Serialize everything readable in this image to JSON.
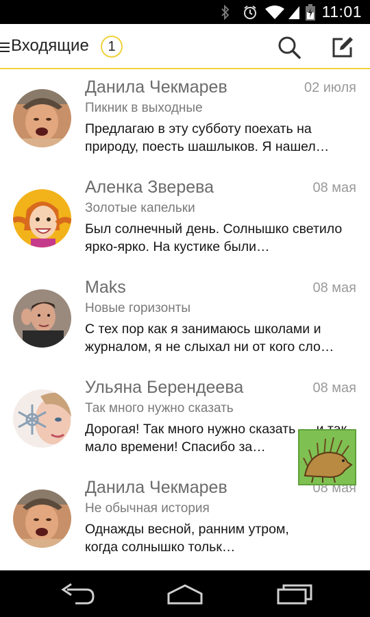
{
  "status_bar": {
    "time": "11:01",
    "icons": [
      "bluetooth-icon",
      "alarm-icon",
      "wifi-icon",
      "signal-icon",
      "battery-icon"
    ]
  },
  "header": {
    "title": "Входящие",
    "unread_count": "1",
    "accent_color": "#f0d23b"
  },
  "messages": [
    {
      "sender": "Данила Чекмарев",
      "date": "02 июля",
      "subject": "Пикник в выходные",
      "preview": "Предлагаю в эту субботу поехать на природу, поесть шашлыков. Я нашел…"
    },
    {
      "sender": "Аленка Зверева",
      "date": "08 мая",
      "subject": "Золотые капельки",
      "preview": "Был солнечный день. Солнышко светило ярко-ярко. На кустике были…"
    },
    {
      "sender": "Maks",
      "date": "08 мая",
      "subject": "Новые горизонты",
      "preview": "С тех пор как я занимаюсь школами и журналом, я не слыхал ни от кого сло…"
    },
    {
      "sender": "Ульяна Берендеева",
      "date": "08 мая",
      "subject": "Так много нужно сказать",
      "preview": "Дорогая! Так много нужно сказать — и так мало времени! Спасибо за…"
    },
    {
      "sender": "Данила Чекмарев",
      "date": "08 мая",
      "subject": "Не обычная история",
      "preview": "Однажды весной, ранним утром, когда солнышко тольк…"
    }
  ],
  "navigation": [
    "back-icon",
    "home-icon",
    "recent-apps-icon"
  ]
}
